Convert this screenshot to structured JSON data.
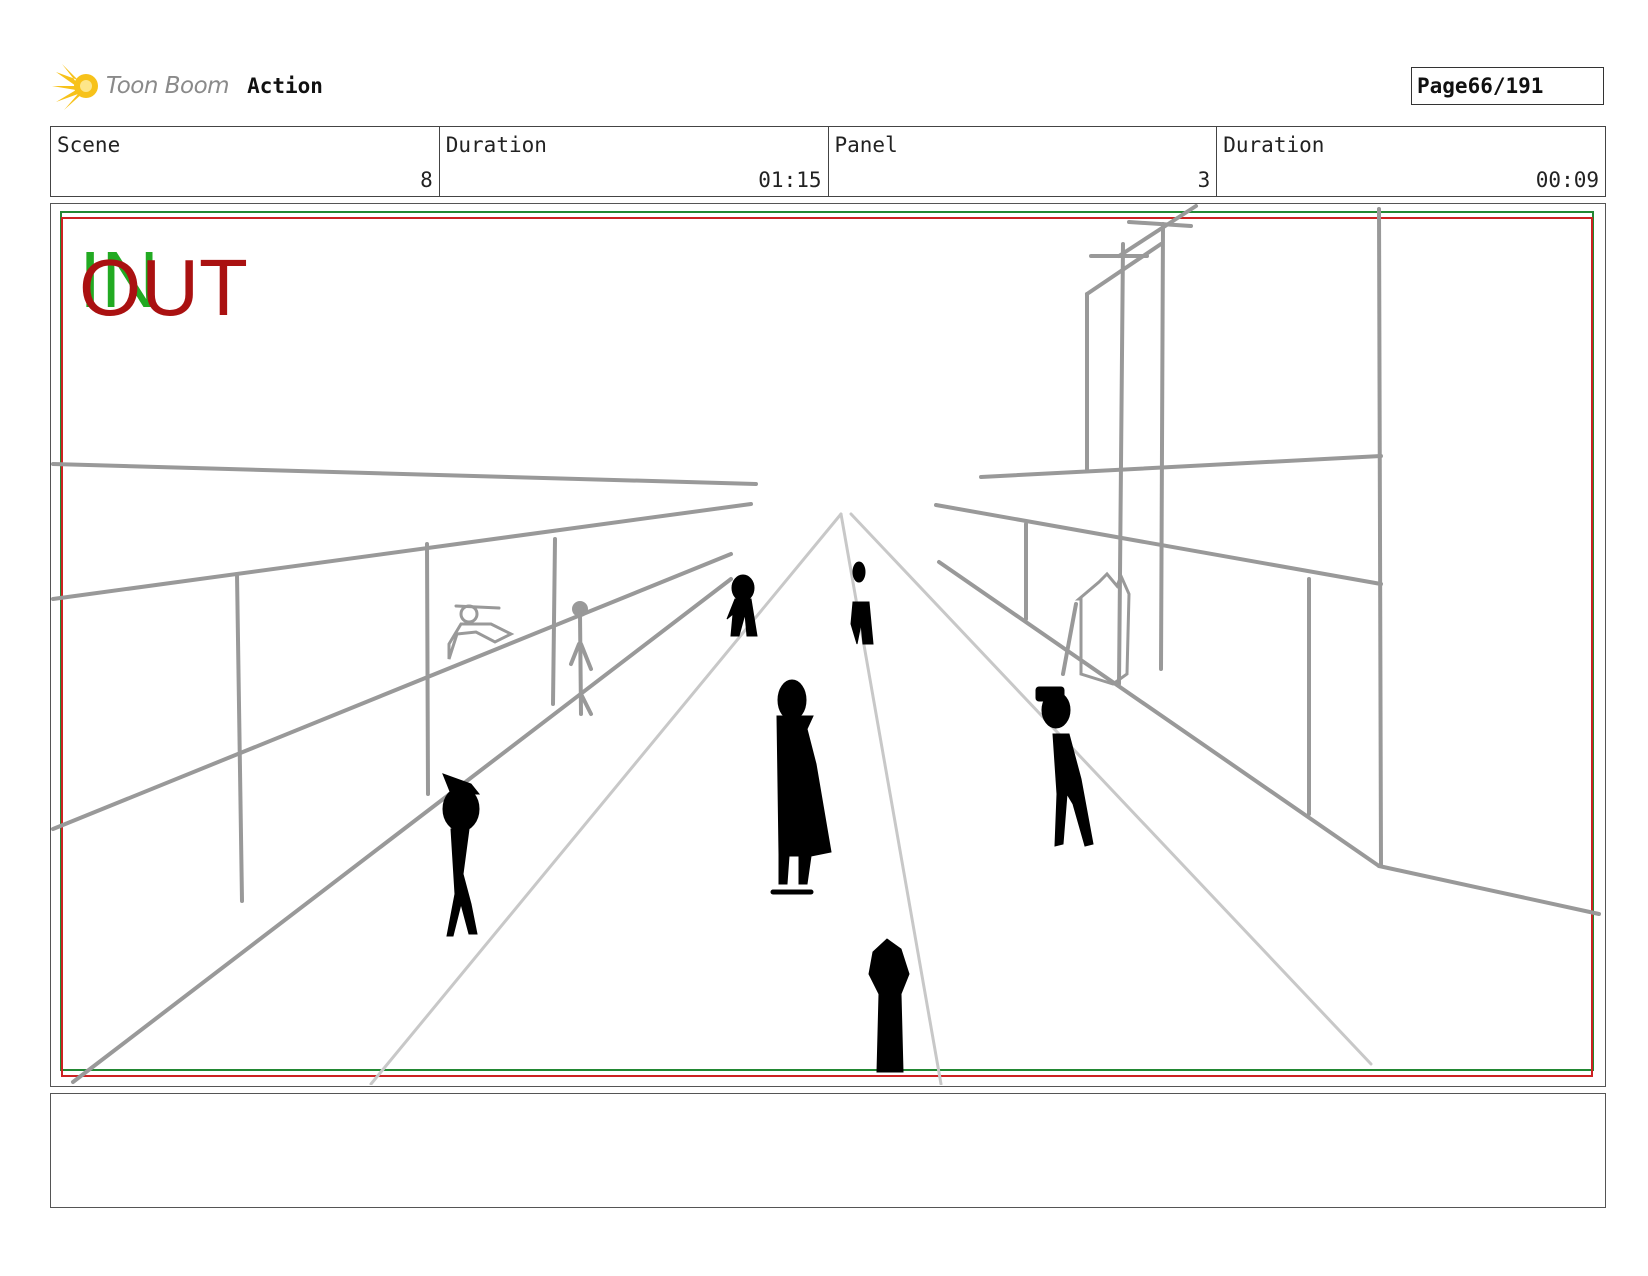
{
  "header": {
    "logo_brand": "Toon Boom",
    "logo_app": "Action",
    "page_label": "Page",
    "page_value": "66/191"
  },
  "info": {
    "scene_label": "Scene",
    "scene_value": "8",
    "scene_duration_label": "Duration",
    "scene_duration_value": "01:15",
    "panel_label": "Panel",
    "panel_value": "3",
    "panel_duration_label": "Duration",
    "panel_duration_value": "00:09"
  },
  "panel": {
    "marker_in": "IN",
    "marker_out": "OUT",
    "colors": {
      "safe_frame": "#cc2222",
      "title_safe": "#228833",
      "sketch_gray": "#999999",
      "light_gray": "#c8c8c8",
      "ink": "#000000"
    }
  },
  "notes": {
    "text": ""
  }
}
